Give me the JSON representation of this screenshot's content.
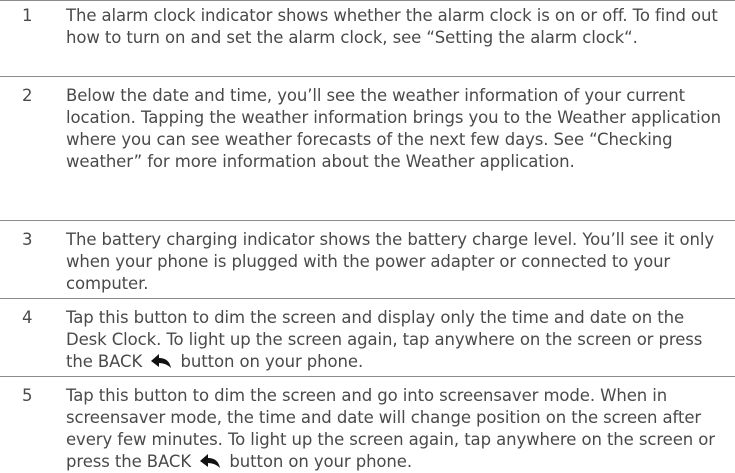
{
  "items": [
    {
      "number": "1",
      "text": "The alarm clock indicator shows whether the alarm clock is on or off. To find out how to turn on and set the alarm clock, see “Setting the alarm clock“."
    },
    {
      "number": "2",
      "text": "Below the date and time, you’ll see the weather information of your current location. Tapping the weather information brings you to the Weather application where you can see weather forecasts of the next few days. See “Checking weather” for more information about the Weather application."
    },
    {
      "number": "3",
      "text": "The battery charging indicator shows the battery charge level. You’ll see it only when your phone is plugged with the power adapter or connected to your computer."
    },
    {
      "number": "4",
      "text_before_icon": "Tap this button to dim the screen and display only the time and date on the Desk Clock. To light up the screen again, tap anywhere on the screen or press the BACK",
      "icon": "back-arrow-icon",
      "text_after_icon": "button on your phone."
    },
    {
      "number": "5",
      "text_before_icon": "Tap this button to dim the screen and go into screensaver mode. When in screensaver mode, the time and date will change position on the screen after every few minutes. To light up the screen again, tap anywhere on the screen or press the BACK",
      "icon": "back-arrow-icon",
      "text_after_icon": "button on your phone."
    }
  ]
}
